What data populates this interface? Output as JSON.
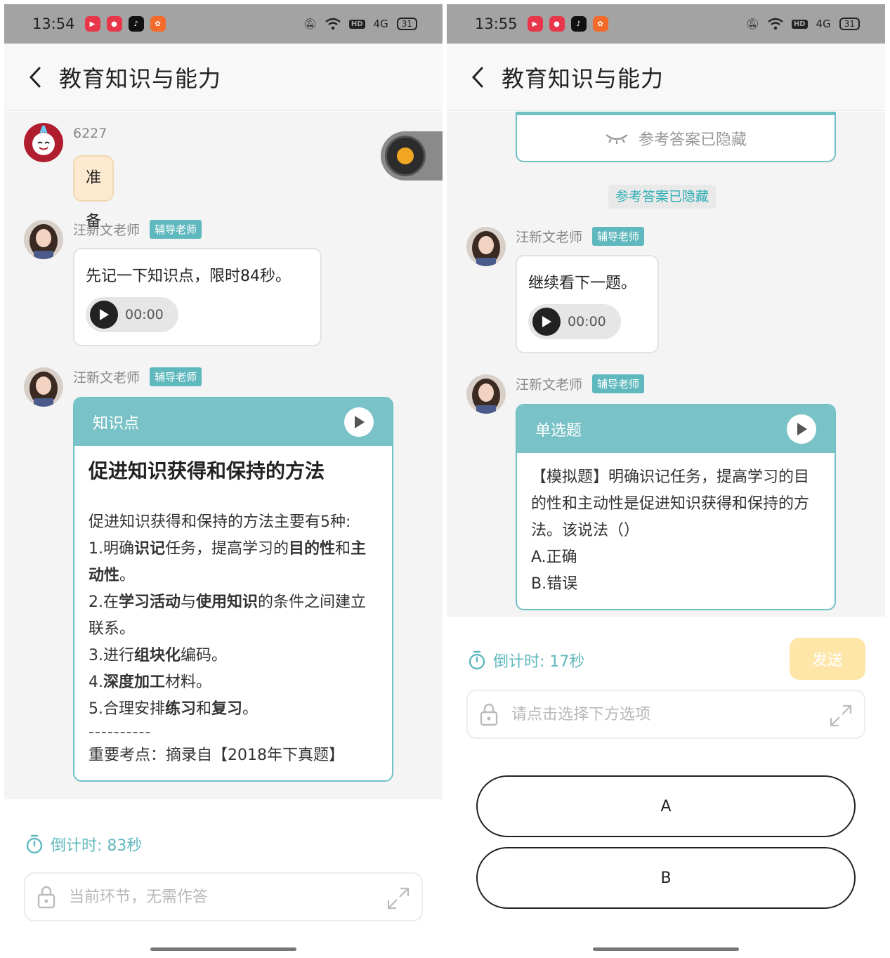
{
  "left": {
    "status": {
      "time": "13:54",
      "battery": "31",
      "network": "4G"
    },
    "header": {
      "title": "教育知识与能力"
    },
    "messages": {
      "user": {
        "name": "6227",
        "text": "准备好了"
      },
      "teacher1": {
        "name": "汪新文老师",
        "tag": "辅导老师",
        "text": "先记一下知识点，限时84秒。",
        "voice_time": "00:00"
      },
      "teacher2": {
        "name": "汪新文老师",
        "tag": "辅导老师",
        "card": {
          "header": "知识点",
          "title": "促进知识获得和保持的方法",
          "intro": "促进知识获得和保持的方法主要有5种:",
          "divider": "----------",
          "source": "重要考点：摘录自【2018年下真题】"
        }
      }
    },
    "footer": {
      "countdown": "倒计时: 83秒",
      "placeholder": "当前环节，无需作答"
    }
  },
  "right": {
    "status": {
      "time": "13:55",
      "battery": "31",
      "network": "4G"
    },
    "header": {
      "title": "教育知识与能力"
    },
    "answer_hidden_box": "参考答案已隐藏",
    "answer_hidden_pill": "参考答案已隐藏",
    "messages": {
      "teacher1": {
        "name": "汪新文老师",
        "tag": "辅导老师",
        "text": "继续看下一题。",
        "voice_time": "00:00"
      },
      "teacher2": {
        "name": "汪新文老师",
        "tag": "辅导老师",
        "card": {
          "header": "单选题",
          "question": "【模拟题】明确识记任务，提高学习的目的性和主动性是促进知识获得和保持的方法。该说法（）",
          "option_a": "A.正确",
          "option_b": "B.错误"
        }
      }
    },
    "footer": {
      "countdown": "倒计时: 17秒",
      "send": "发送",
      "placeholder": "请点击选择下方选项"
    },
    "options": [
      "A",
      "B"
    ]
  },
  "colors": {
    "teal": "#79c2c7",
    "teal_text": "#5fb8bd",
    "user_bubble": "#fde9cf",
    "send_disabled": "#fde6a8"
  }
}
